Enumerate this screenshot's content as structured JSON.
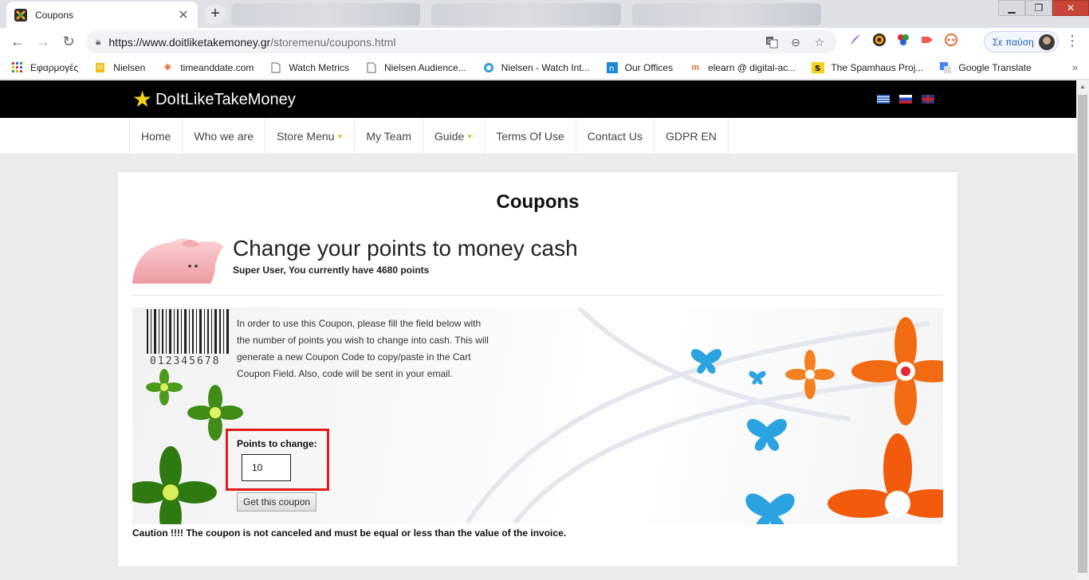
{
  "browser": {
    "active_tab_title": "Coupons",
    "url_host": "https://www.doitliketakemoney.gr",
    "url_path": "/storemenu/coupons.html",
    "pause_label": "Σε παύση",
    "bookmarks": [
      {
        "label": "Εφαρμογές",
        "icon": "apps-grid-icon"
      },
      {
        "label": "Nielsen",
        "icon": "folder-icon"
      },
      {
        "label": "timeanddate.com",
        "icon": "sparkle-icon"
      },
      {
        "label": "Watch Metrics",
        "icon": "page-icon"
      },
      {
        "label": "Nielsen Audience...",
        "icon": "page-icon"
      },
      {
        "label": "Nielsen - Watch Int...",
        "icon": "globe-icon"
      },
      {
        "label": "Our Offices",
        "icon": "n-logo-icon"
      },
      {
        "label": "elearn @ digital-ac...",
        "icon": "moodle-icon"
      },
      {
        "label": "The Spamhaus Proj...",
        "icon": "spamhaus-icon"
      },
      {
        "label": "Google Translate",
        "icon": "translate-icon"
      }
    ]
  },
  "site": {
    "logo_text": "DoItLikeTakeMoney",
    "nav": [
      {
        "label": "Home",
        "dropdown": false
      },
      {
        "label": "Who we are",
        "dropdown": false
      },
      {
        "label": "Store Menu",
        "dropdown": true
      },
      {
        "label": "My Team",
        "dropdown": false
      },
      {
        "label": "Guide",
        "dropdown": true
      },
      {
        "label": "Terms Of Use",
        "dropdown": false
      },
      {
        "label": "Contact Us",
        "dropdown": false
      },
      {
        "label": "GDPR EN",
        "dropdown": false
      }
    ]
  },
  "page": {
    "title": "Coupons",
    "heading": "Change your points to money cash",
    "points_line": "Super User, You currently have 4680 points",
    "instructions": "In order to use this Coupon, please fill the field below with the number of points you wish to change into cash. This will generate a new Coupon Code to copy/paste in the Cart Coupon Field. Also, code will be sent in your email.",
    "barcode_number": "012345678",
    "points_label": "Points to change:",
    "points_value": "10",
    "button_label": "Get this coupon",
    "caution": "Caution !!!! The coupon is not canceled and must be equal or less than the value of the invoice."
  },
  "colors": {
    "header_bg": "#000000",
    "logo_star": "#f4d21c",
    "nav_caret": "#f0b400",
    "highlight": "#e21a1a",
    "flower_orange": "#f26a12",
    "butterfly_blue": "#2aa3e0",
    "flower_green": "#3f8d16"
  }
}
